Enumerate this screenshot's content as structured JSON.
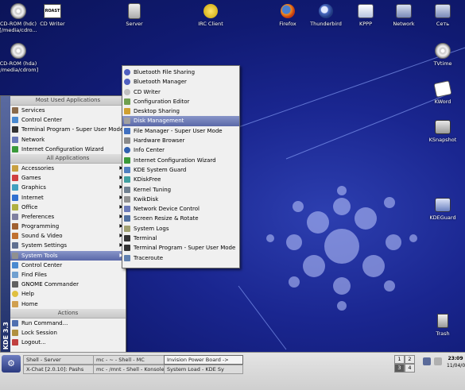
{
  "desktop_icons": [
    {
      "label": "CD-ROM (hdc)",
      "sublabel": "[/media/cdro...",
      "icon": "cdrom-icon"
    },
    {
      "label": "CD Writer",
      "sublabel": "",
      "icon": "cd-writer-icon",
      "badge": "ROAST"
    },
    {
      "label": "Server",
      "sublabel": "",
      "icon": "server-icon"
    },
    {
      "label": "IRC Client",
      "sublabel": "",
      "icon": "irc-client-icon"
    },
    {
      "label": "Firefox",
      "sublabel": "",
      "icon": "firefox-icon"
    },
    {
      "label": "Thunderbird",
      "sublabel": "",
      "icon": "thunderbird-icon"
    },
    {
      "label": "KPPP",
      "sublabel": "",
      "icon": "kppp-icon"
    },
    {
      "label": "Network",
      "sublabel": "",
      "icon": "network-icon"
    },
    {
      "label": "Сеть",
      "sublabel": "",
      "icon": "network-ru-icon"
    },
    {
      "label": "CD-ROM (hda)",
      "sublabel": "[/media/cdrom]",
      "icon": "cdrom-icon"
    },
    {
      "label": "TVtime",
      "sublabel": "",
      "icon": "tvtime-icon"
    },
    {
      "label": "KWord",
      "sublabel": "",
      "icon": "kword-icon"
    },
    {
      "label": "KSnapshot",
      "sublabel": "",
      "icon": "ksnapshot-icon"
    },
    {
      "label": "KDEGuard",
      "sublabel": "",
      "icon": "kdeguard-icon"
    },
    {
      "label": "Trash",
      "sublabel": "",
      "icon": "trash-icon"
    }
  ],
  "kmenu": {
    "side_label": "KDE 3.3",
    "most_used_header": "Most Used Applications",
    "most_used": [
      "Services",
      "Control Center",
      "Terminal Program - Super User Mode",
      "Network",
      "Internet Configuration Wizard"
    ],
    "all_header": "All Applications",
    "all_apps": [
      "Accessories",
      "Games",
      "Graphics",
      "Internet",
      "Office",
      "Preferences",
      "Programming",
      "Sound & Video",
      "System Settings",
      "System Tools"
    ],
    "selected": "System Tools",
    "extra": [
      "Control Center",
      "Find Files",
      "GNOME Commander",
      "Help",
      "Home"
    ],
    "actions_header": "Actions",
    "actions": [
      "Run Command...",
      "Lock Session",
      "Logout..."
    ]
  },
  "submenu": {
    "items": [
      "Bluetooth File Sharing",
      "Bluetooth Manager",
      "CD Writer",
      "Configuration Editor",
      "Desktop Sharing",
      "Disk Management",
      "File Manager - Super User Mode",
      "Hardware Browser",
      "Info Center",
      "Internet Configuration Wizard",
      "KDE System Guard",
      "KDiskFree",
      "Kernel Tuning",
      "KwikDisk",
      "Network Device Control",
      "Screen Resize & Rotate",
      "System Logs",
      "Terminal",
      "Terminal Program - Super User Mode",
      "Traceroute"
    ],
    "selected": "Disk Management"
  },
  "taskbar": {
    "tasks": [
      "Shell - Server",
      "mc - ~ - Shell - MC",
      "Invision Power Board ->",
      "X-Chat [2.0.10]: Pashs",
      "mc - /mnt - Shell - Konsole",
      "System Load - KDE Sy"
    ],
    "pager": [
      "1",
      "2",
      "3",
      "4"
    ],
    "current_desktop": "3",
    "clock_time": "23:09",
    "clock_date": "11/04/05"
  },
  "colors": {
    "selection": "#5a68a8",
    "desktop": "#1a2690"
  }
}
